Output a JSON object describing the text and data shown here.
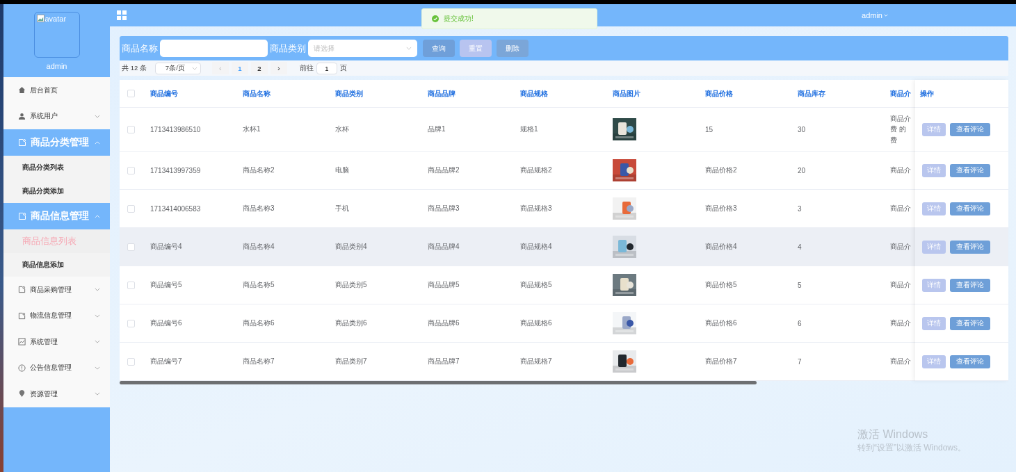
{
  "sidebar": {
    "avatar_alt": "avatar",
    "username": "admin",
    "menu": [
      {
        "label": "后台首页",
        "kind": "link"
      },
      {
        "label": "系统用户",
        "kind": "submenu",
        "expanded": false
      },
      {
        "label": "商品分类管理",
        "kind": "submenu",
        "expanded": true,
        "children": [
          {
            "label": "商品分类列表",
            "selected": false
          },
          {
            "label": "商品分类添加",
            "selected": false
          }
        ]
      },
      {
        "label": "商品信息管理",
        "kind": "submenu",
        "expanded": true,
        "children": [
          {
            "label": "商品信息列表",
            "selected": true
          },
          {
            "label": "商品信息添加",
            "selected": false
          }
        ]
      },
      {
        "label": "商品采购管理",
        "kind": "submenu",
        "expanded": false
      },
      {
        "label": "物流信息管理",
        "kind": "submenu",
        "expanded": false
      },
      {
        "label": "系统管理",
        "kind": "submenu",
        "expanded": false
      },
      {
        "label": "公告信息管理",
        "kind": "submenu",
        "expanded": false
      },
      {
        "label": "资源管理",
        "kind": "submenu",
        "expanded": false
      }
    ]
  },
  "header": {
    "user": "admin"
  },
  "toast": {
    "message": "提交成功!"
  },
  "search": {
    "name_label": "商品名称",
    "category_label": "商品类别",
    "category_placeholder": "请选择",
    "buttons": [
      {
        "label": "查询",
        "kind": "query"
      },
      {
        "label": "重置",
        "kind": "reset"
      },
      {
        "label": "删除",
        "kind": "delete"
      }
    ]
  },
  "pagination": {
    "total": "共 12 条",
    "page_size": "7条/页",
    "prev": "‹",
    "next": "›",
    "pages": [
      {
        "label": "1",
        "selected": true
      },
      {
        "label": "2",
        "selected": false
      }
    ],
    "goto_label": "前往",
    "goto_value": "1",
    "goto_suffix": "页"
  },
  "table": {
    "select_all_checked": false,
    "columns": [
      "商品编号",
      "商品名称",
      "商品类别",
      "商品品牌",
      "商品规格",
      "商品图片",
      "商品价格",
      "商品库存",
      "商品介"
    ],
    "actions_column": "操作",
    "rows": [
      {
        "checked": false,
        "highlighted": false,
        "cells": [
          "1713413986510",
          "水杯1",
          "水杯",
          "品牌1",
          "规格1",
          {
            "kind": "picture"
          },
          "15",
          "30",
          "商品介费 的费"
        ],
        "actions": [
          "详情",
          "查看评论"
        ]
      },
      {
        "checked": false,
        "highlighted": false,
        "cells": [
          "1713413997359",
          "商品名称2",
          "电脑",
          "商品品牌2",
          "商品规格2",
          {
            "kind": "picture"
          },
          "商品价格2",
          "20",
          "商品介"
        ],
        "actions": [
          "详情",
          "查看评论"
        ]
      },
      {
        "checked": false,
        "highlighted": false,
        "cells": [
          "1713414006583",
          "商品名称3",
          "手机",
          "商品品牌3",
          "商品规格3",
          {
            "kind": "picture"
          },
          "商品价格3",
          "3",
          "商品介"
        ],
        "actions": [
          "详情",
          "查看评论"
        ]
      },
      {
        "checked": false,
        "highlighted": true,
        "cells": [
          "商品编号4",
          "商品名称4",
          "商品类别4",
          "商品品牌4",
          "商品规格4",
          {
            "kind": "picture"
          },
          "商品价格4",
          "4",
          "商品介"
        ],
        "actions": [
          "详情",
          "查看评论"
        ]
      },
      {
        "checked": false,
        "highlighted": false,
        "cells": [
          "商品编号5",
          "商品名称5",
          "商品类别5",
          "商品品牌5",
          "商品规格5",
          {
            "kind": "picture"
          },
          "商品价格5",
          "5",
          "商品介"
        ],
        "actions": [
          "详情",
          "查看评论"
        ]
      },
      {
        "checked": false,
        "highlighted": false,
        "cells": [
          "商品编号6",
          "商品名称6",
          "商品类别6",
          "商品品牌6",
          "商品规格6",
          {
            "kind": "picture"
          },
          "商品价格6",
          "6",
          "商品介"
        ],
        "actions": [
          "详情",
          "查看评论"
        ]
      },
      {
        "checked": false,
        "highlighted": false,
        "cells": [
          "商品编号7",
          "商品名称7",
          "商品类别7",
          "商品品牌7",
          "商品规格7",
          {
            "kind": "picture"
          },
          "商品价格7",
          "7",
          "商品介"
        ],
        "actions": [
          "详情",
          "查看评论"
        ]
      }
    ]
  },
  "watermark": {
    "title": "激活 Windows",
    "subtitle": "转到“设置”以激活 Windows。"
  }
}
